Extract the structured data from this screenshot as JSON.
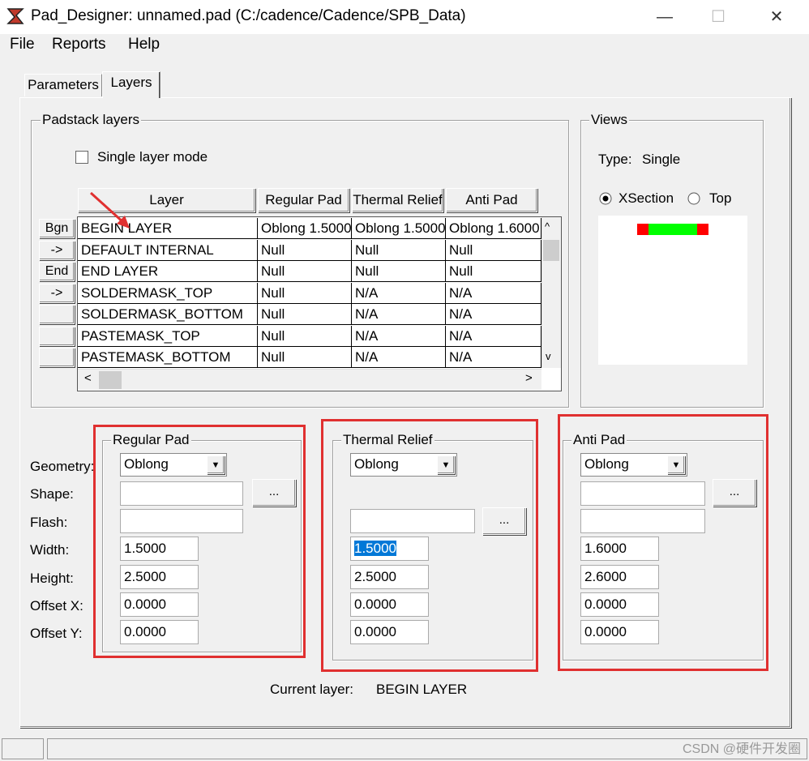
{
  "window": {
    "title": "Pad_Designer: unnamed.pad (C:/cadence/Cadence/SPB_Data)",
    "minimize": "—",
    "maximize": "☐",
    "close": "✕"
  },
  "menu": [
    {
      "label": "File"
    },
    {
      "label": "Reports"
    },
    {
      "label": "Help"
    }
  ],
  "tabs": [
    {
      "label": "Parameters",
      "active": false
    },
    {
      "label": "Layers",
      "active": true
    }
  ],
  "padstack": {
    "group_label": "Padstack layers",
    "single_layer_mode_label": "Single layer mode",
    "single_layer_mode_checked": false,
    "columns": [
      "Layer",
      "Regular Pad",
      "Thermal Relief",
      "Anti Pad"
    ],
    "row_buttons": [
      "Bgn",
      "->",
      "End",
      "->",
      "",
      "",
      ""
    ],
    "rows": [
      [
        "BEGIN LAYER",
        "Oblong 1.5000",
        "Oblong 1.5000",
        "Oblong 1.6000"
      ],
      [
        "DEFAULT INTERNAL",
        "Null",
        "Null",
        "Null"
      ],
      [
        "END LAYER",
        "Null",
        "Null",
        "Null"
      ],
      [
        "SOLDERMASK_TOP",
        "Null",
        "N/A",
        "N/A"
      ],
      [
        "SOLDERMASK_BOTTOM",
        "Null",
        "N/A",
        "N/A"
      ],
      [
        "PASTEMASK_TOP",
        "Null",
        "N/A",
        "N/A"
      ],
      [
        "PASTEMASK_BOTTOM",
        "Null",
        "N/A",
        "N/A"
      ]
    ],
    "scroll_up": "^",
    "scroll_down": "v",
    "scroll_left": "<",
    "scroll_right": ">"
  },
  "views": {
    "group_label": "Views",
    "type_label": "Type:",
    "type_value": "Single",
    "xsection_label": "XSection",
    "top_label": "Top",
    "selected_view": "XSection",
    "preview_colors": {
      "pad_end": "#ff0000",
      "pad_middle": "#00ff00"
    }
  },
  "field_labels": [
    "Geometry:",
    "Shape:",
    "Flash:",
    "Width:",
    "Height:",
    "Offset X:",
    "Offset Y:"
  ],
  "regular_pad": {
    "label": "Regular Pad",
    "geometry": "Oblong",
    "shape": "",
    "flash": "",
    "width": "1.5000",
    "height": "2.5000",
    "offset_x": "0.0000",
    "offset_y": "0.0000",
    "browse_label": "..."
  },
  "thermal_relief": {
    "label": "Thermal Relief",
    "geometry": "Oblong",
    "flash": "",
    "width": "1.5000",
    "height": "2.5000",
    "offset_x": "0.0000",
    "offset_y": "0.0000",
    "browse_label": "..."
  },
  "anti_pad": {
    "label": "Anti Pad",
    "geometry": "Oblong",
    "shape": "",
    "flash": "",
    "width": "1.6000",
    "height": "2.6000",
    "offset_x": "0.0000",
    "offset_y": "0.0000",
    "browse_label": "..."
  },
  "current_layer": {
    "label": "Current layer:",
    "value": "BEGIN LAYER"
  },
  "watermark": "CSDN @硬件开发圈",
  "annotation_color": "#e03030"
}
